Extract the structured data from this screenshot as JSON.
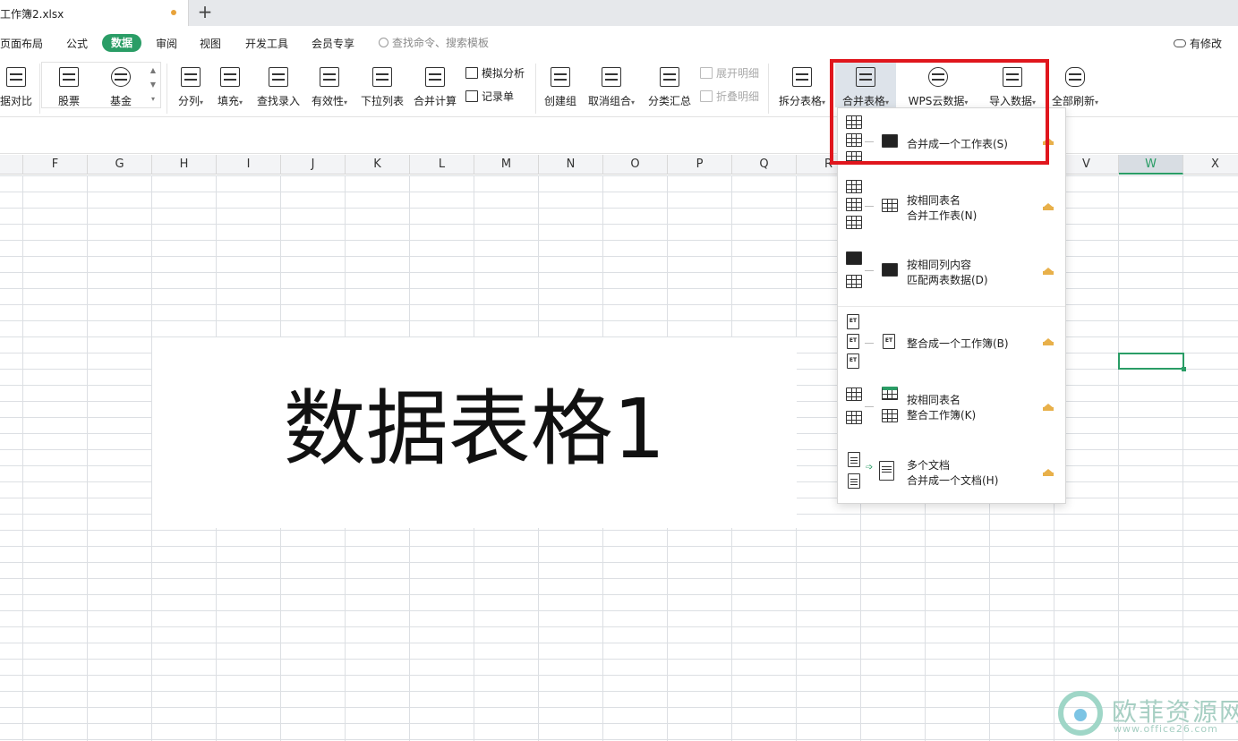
{
  "titlebar": {
    "doc_name": "工作簿2.xlsx",
    "new_tab": "+"
  },
  "menu": {
    "items": [
      "页面布局",
      "公式",
      "数据",
      "审阅",
      "视图",
      "开发工具",
      "会员专享"
    ],
    "active": "数据",
    "search_placeholder": "查找命令、搜索模板",
    "modified": "有修改"
  },
  "ribbon": {
    "compare": "据对比",
    "stock": "股票",
    "fund": "基金",
    "split_col": "分列",
    "fill": "填充",
    "lookup": "查找录入",
    "validity": "有效性",
    "dropdown_list": "下拉列表",
    "consolidate": "合并计算",
    "simulate": "模拟分析",
    "record": "记录单",
    "create_group": "创建组",
    "ungroup": "取消组合",
    "subtotal": "分类汇总",
    "expand_detail": "展开明细",
    "collapse_detail": "折叠明细",
    "split_table": "拆分表格",
    "merge_table": "合并表格",
    "wps_cloud": "WPS云数据",
    "import_data": "导入数据",
    "refresh_all": "全部刷新"
  },
  "grid": {
    "columns": [
      "F",
      "G",
      "H",
      "I",
      "J",
      "K",
      "L",
      "M",
      "N",
      "O",
      "P",
      "Q",
      "R",
      "V",
      "W",
      "X"
    ],
    "selected_column": "W",
    "textbox": "数据表格1"
  },
  "dropdown": {
    "items": [
      {
        "line1": "合并成一个工作表(S)",
        "line2": ""
      },
      {
        "line1": "按相同表名",
        "line2": "合并工作表(N)"
      },
      {
        "line1": "按相同列内容",
        "line2": "匹配两表数据(D)"
      },
      {
        "line1": "整合成一个工作簿(B)",
        "line2": ""
      },
      {
        "line1": "按相同表名",
        "line2": "整合工作簿(K)"
      },
      {
        "line1": "多个文档",
        "line2": "合并成一个文档(H)"
      }
    ]
  },
  "watermark": {
    "cn": "欧菲资源网",
    "en": "www.office26.com"
  },
  "colors": {
    "accent": "#2a9d66",
    "highlight": "#e0161d",
    "crown": "#e8b04a"
  }
}
